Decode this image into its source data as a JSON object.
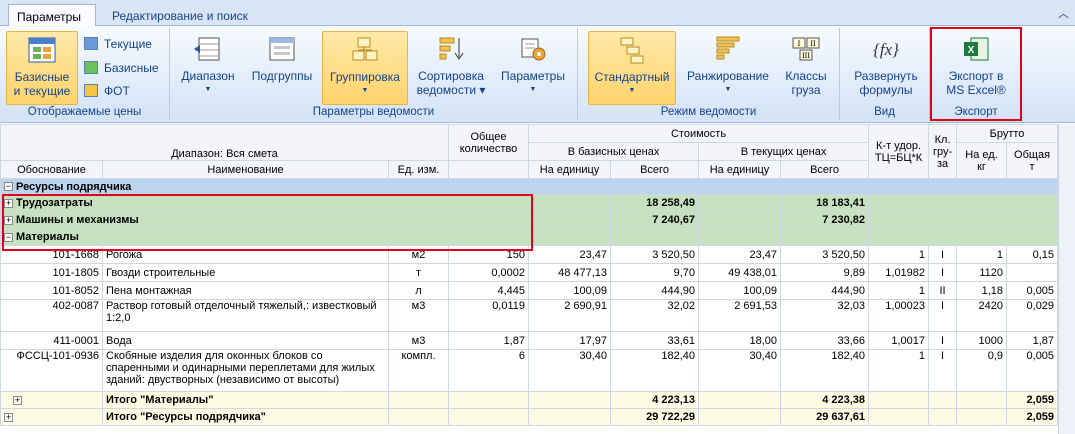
{
  "tabs": {
    "params": "Параметры",
    "edit": "Редактирование и поиск"
  },
  "ribbon": {
    "prices": {
      "label": "Отображаемые цены",
      "basic_current": [
        "Базисные",
        "и текущие"
      ],
      "current": "Текущие",
      "basic": "Базисные",
      "fot": "ФОТ"
    },
    "sheet": {
      "label": "Параметры ведомости",
      "range": "Диапазон",
      "subgroups": "Подгруппы",
      "grouping": "Группировка",
      "sort": [
        "Сортировка",
        "ведомости"
      ],
      "params": "Параметры"
    },
    "mode": {
      "label": "Режим ведомости",
      "standard": "Стандартный",
      "ranking": "Ранжирование",
      "classes": [
        "Классы",
        "груза"
      ]
    },
    "view": {
      "label": "Вид",
      "expand": [
        "Развернуть",
        "формулы"
      ]
    },
    "export": {
      "label": "Экспорт",
      "excel": [
        "Экспорт в",
        "MS Excel®"
      ]
    }
  },
  "grid": {
    "headers": {
      "range": "Диапазон: Вся смета",
      "qty": "Общее количество",
      "cost": "Стоимость",
      "basic": "В базисных ценах",
      "current": "В текущих ценах",
      "coef": "К-т удор. ТЦ=БЦ*К",
      "cls": "Кл. гру- за",
      "brutto": "Брутто",
      "basis": "Обоснование",
      "name": "Наименование",
      "unit": "Ед. изм.",
      "per_unit": "На единицу",
      "total": "Всего",
      "per_unit_kg": "На ед. кг",
      "total_t": "Общая т"
    },
    "group_top": "Ресурсы подрядчика",
    "groups": [
      {
        "name": "Трудозатраты",
        "basic_total": "18 258,49",
        "cur_total": "18 183,41",
        "sign": "+"
      },
      {
        "name": "Машины и механизмы",
        "basic_total": "7 240,67",
        "cur_total": "7 230,82",
        "sign": "+"
      },
      {
        "name": "Материалы",
        "basic_total": "",
        "cur_total": "",
        "sign": "−"
      }
    ],
    "rows": [
      {
        "code": "101-1668",
        "name": "Рогожа",
        "unit": "м2",
        "qty": "150",
        "bu": "23,47",
        "bt": "3 520,50",
        "cu": "23,47",
        "ct": "3 520,50",
        "k": "1",
        "cls": "I",
        "kg": "1",
        "t": "0,15"
      },
      {
        "code": "101-1805",
        "name": "Гвозди строительные",
        "unit": "т",
        "qty": "0,0002",
        "bu": "48 477,13",
        "bt": "9,70",
        "cu": "49 438,01",
        "ct": "9,89",
        "k": "1,01982",
        "cls": "I",
        "kg": "1120",
        "t": ""
      },
      {
        "code": "101-8052",
        "name": "Пена монтажная",
        "unit": "л",
        "qty": "4,445",
        "bu": "100,09",
        "bt": "444,90",
        "cu": "100,09",
        "ct": "444,90",
        "k": "1",
        "cls": "II",
        "kg": "1,18",
        "t": "0,005"
      },
      {
        "code": "402-0087",
        "name": "Раствор готовый отделочный тяжелый,: известковый 1:2,0",
        "unit": "м3",
        "qty": "0,0119",
        "bu": "2 690,91",
        "bt": "32,02",
        "cu": "2 691,53",
        "ct": "32,03",
        "k": "1,00023",
        "cls": "I",
        "kg": "2420",
        "t": "0,029"
      },
      {
        "code": "411-0001",
        "name": "Вода",
        "unit": "м3",
        "qty": "1,87",
        "bu": "17,97",
        "bt": "33,61",
        "cu": "18,00",
        "ct": "33,66",
        "k": "1,0017",
        "cls": "I",
        "kg": "1000",
        "t": "1,87"
      },
      {
        "code": "ФССЦ-101-0936",
        "name": "Скобяные изделия для оконных блоков со спаренными и одинарными переплетами для жилых зданий: двустворных (независимо от высоты)",
        "unit": "компл.",
        "qty": "6",
        "bu": "30,40",
        "bt": "182,40",
        "cu": "30,40",
        "ct": "182,40",
        "k": "1",
        "cls": "I",
        "kg": "0,9",
        "t": "0,005"
      }
    ],
    "totals": [
      {
        "name": "Итого \"Материалы\"",
        "bt": "4 223,13",
        "ct": "4 223,38",
        "t": "2,059"
      },
      {
        "name": "Итого \"Ресурсы подрядчика\"",
        "bt": "29 722,29",
        "ct": "29 637,61",
        "t": "2,059"
      }
    ]
  },
  "colors": {
    "highlight": "#e0001b",
    "group_green": "#c5e1c0",
    "group_blue": "#bcd4ee",
    "selected": "#ffd36b"
  }
}
